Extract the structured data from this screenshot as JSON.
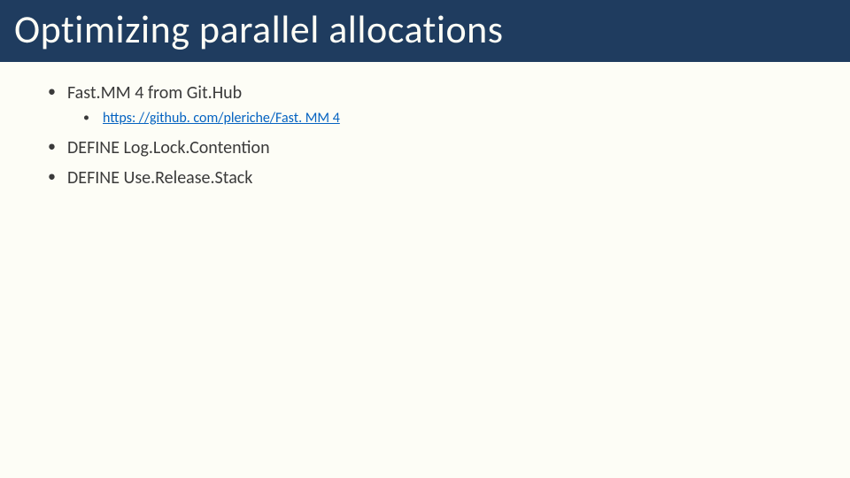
{
  "title": "Optimizing parallel allocations",
  "bullets": [
    {
      "text": "Fast.MM 4 from Git.Hub",
      "sub": [
        {
          "href": "https: //github. com/pleriche/Fast. MM 4"
        }
      ]
    },
    {
      "text": "DEFINE Log.Lock.Contention"
    },
    {
      "text": "DEFINE Use.Release.Stack"
    }
  ]
}
